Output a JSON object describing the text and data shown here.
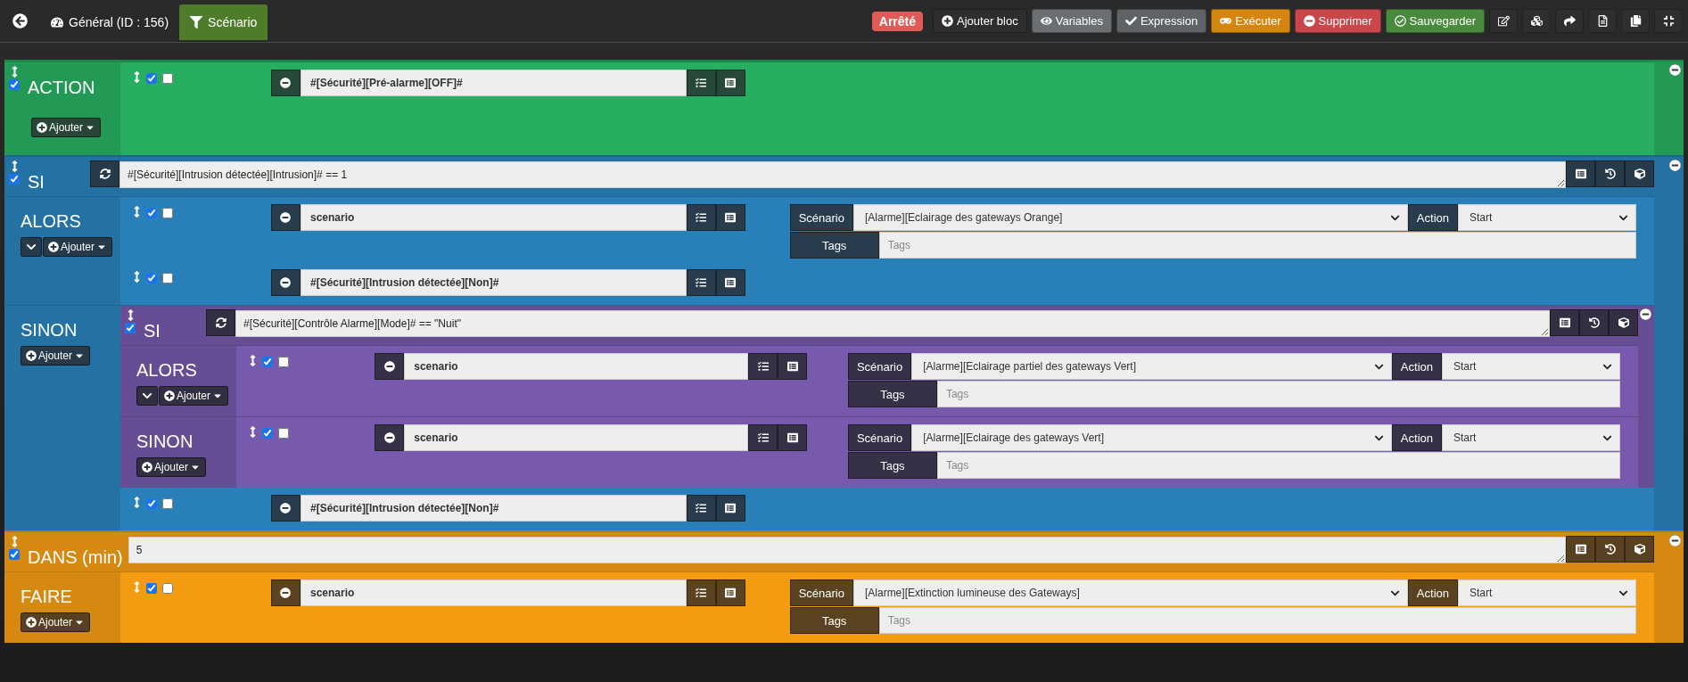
{
  "tabs": [
    {
      "kind": "general",
      "label": "Général (ID : 156)",
      "selected": false
    },
    {
      "kind": "scenario",
      "label": "Scénario",
      "selected": true
    }
  ],
  "status": {
    "label": "Arrêté"
  },
  "actions": [
    {
      "kind": "add",
      "label": "Ajouter bloc"
    },
    {
      "kind": "variables",
      "label": "Variables"
    },
    {
      "kind": "expression",
      "label": "Expression"
    },
    {
      "kind": "run",
      "label": "Exécuter"
    },
    {
      "kind": "delete",
      "label": "Supprimer"
    },
    {
      "kind": "save",
      "label": "Sauvegarder"
    }
  ],
  "blocks": [
    {
      "kind": "action",
      "checked": true,
      "sections": [
        {
          "label": "ACTION",
          "add_label": "Ajouter",
          "elements": [
            {
              "kind": "command",
              "enabled": true,
              "parallel": false,
              "command": "#[Sécurité][Pré-alarme][OFF]#"
            }
          ]
        }
      ]
    },
    {
      "kind": "if",
      "checked": true,
      "label": "SI",
      "condition": "#[Sécurité][Intrusion détectée][Intrusion]# == 1",
      "sections": [
        {
          "label": "ALORS",
          "collapsible": true,
          "add_label": "Ajouter",
          "elements": [
            {
              "kind": "command",
              "enabled": true,
              "parallel": false,
              "command": "scenario",
              "options": {
                "scenario_label": "Scénario",
                "scenario": "[Alarme][Eclairage des gateways Orange]",
                "action_label": "Action",
                "action": "Start",
                "tags_label": "Tags",
                "tags_placeholder": "Tags"
              }
            },
            {
              "kind": "command",
              "enabled": true,
              "parallel": false,
              "command": "#[Sécurité][Intrusion détectée][Non]#"
            }
          ]
        },
        {
          "label": "SINON",
          "collapsible": false,
          "add_label": "Ajouter",
          "elements": [
            {
              "kind": "block",
              "block": {
                "kind": "if",
                "checked": true,
                "label": "SI",
                "condition": "#[Sécurité][Contrôle Alarme][Mode]# == \"Nuit\"",
                "sections": [
                  {
                    "label": "ALORS",
                    "collapsible": true,
                    "add_label": "Ajouter",
                    "elements": [
                      {
                        "kind": "command",
                        "enabled": true,
                        "parallel": false,
                        "command": "scenario",
                        "options": {
                          "scenario_label": "Scénario",
                          "scenario": "[Alarme][Eclairage partiel des gateways Vert]",
                          "action_label": "Action",
                          "action": "Start",
                          "tags_label": "Tags",
                          "tags_placeholder": "Tags"
                        }
                      }
                    ]
                  },
                  {
                    "label": "SINON",
                    "collapsible": false,
                    "add_label": "Ajouter",
                    "elements": [
                      {
                        "kind": "command",
                        "enabled": true,
                        "parallel": false,
                        "command": "scenario",
                        "options": {
                          "scenario_label": "Scénario",
                          "scenario": "[Alarme][Eclairage des gateways Vert]",
                          "action_label": "Action",
                          "action": "Start",
                          "tags_label": "Tags",
                          "tags_placeholder": "Tags"
                        }
                      }
                    ]
                  }
                ]
              }
            },
            {
              "kind": "command",
              "enabled": true,
              "parallel": false,
              "command": "#[Sécurité][Intrusion détectée][Non]#"
            }
          ]
        }
      ]
    },
    {
      "kind": "in",
      "checked": true,
      "label": "DANS (min)",
      "condition": "5",
      "sections": [
        {
          "label": "FAIRE",
          "collapsible": false,
          "add_label": "Ajouter",
          "elements": [
            {
              "kind": "command",
              "enabled": true,
              "parallel": false,
              "command": "scenario",
              "options": {
                "scenario_label": "Scénario",
                "scenario": "[Alarme][Extinction lumineuse des Gateways]",
                "action_label": "Action",
                "action": "Start",
                "tags_label": "Tags",
                "tags_placeholder": "Tags"
              }
            }
          ]
        }
      ]
    }
  ]
}
